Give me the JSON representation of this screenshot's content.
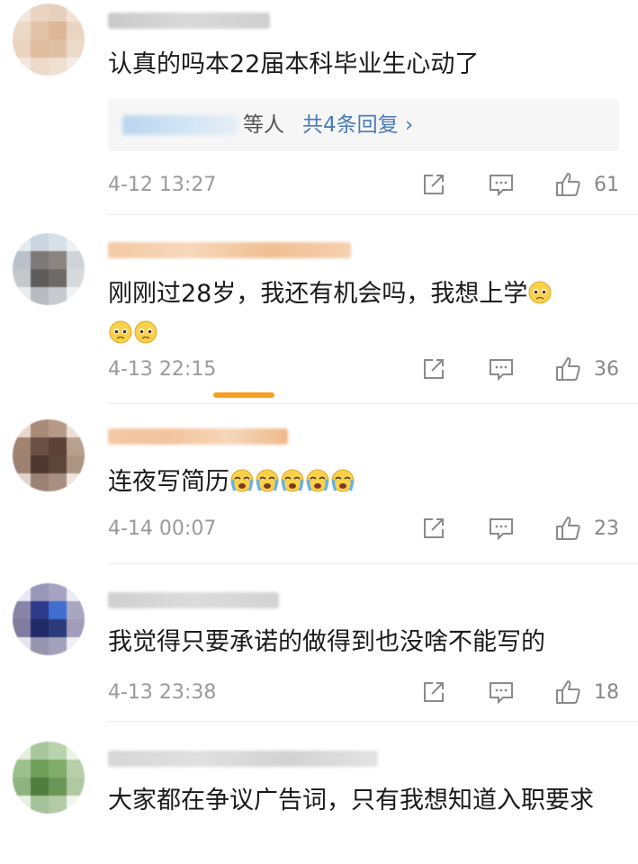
{
  "colors": {
    "accent_link": "#4a7ab8",
    "meta_text": "#9a9a9a",
    "scroll_indicator": "#f5a020"
  },
  "comments": [
    {
      "text": "认真的吗本22届本科毕业生心动了",
      "replies": {
        "others_label": "等人",
        "count_label": "共4条回复 ›"
      },
      "time": "4-12 13:27",
      "likes": "61"
    },
    {
      "text": "刚刚过28岁，我还有机会吗，我想上学",
      "emojis": [
        "pleading-face-emoji",
        "pleading-face-emoji",
        "pleading-face-emoji"
      ],
      "time": "4-13 22:15",
      "likes": "36"
    },
    {
      "text": "连夜写简历",
      "emojis": [
        "crying-face-emoji",
        "crying-face-emoji",
        "crying-face-emoji",
        "crying-face-emoji",
        "crying-face-emoji"
      ],
      "time": "4-14 00:07",
      "likes": "23"
    },
    {
      "text": "我觉得只要承诺的做得到也没啥不能写的",
      "time": "4-13 23:38",
      "likes": "18"
    },
    {
      "text": "大家都在争议广告词，只有我想知道入职要求"
    }
  ],
  "icons": {
    "share": "share-icon",
    "reply": "comment-icon",
    "like": "thumbs-up-icon"
  }
}
